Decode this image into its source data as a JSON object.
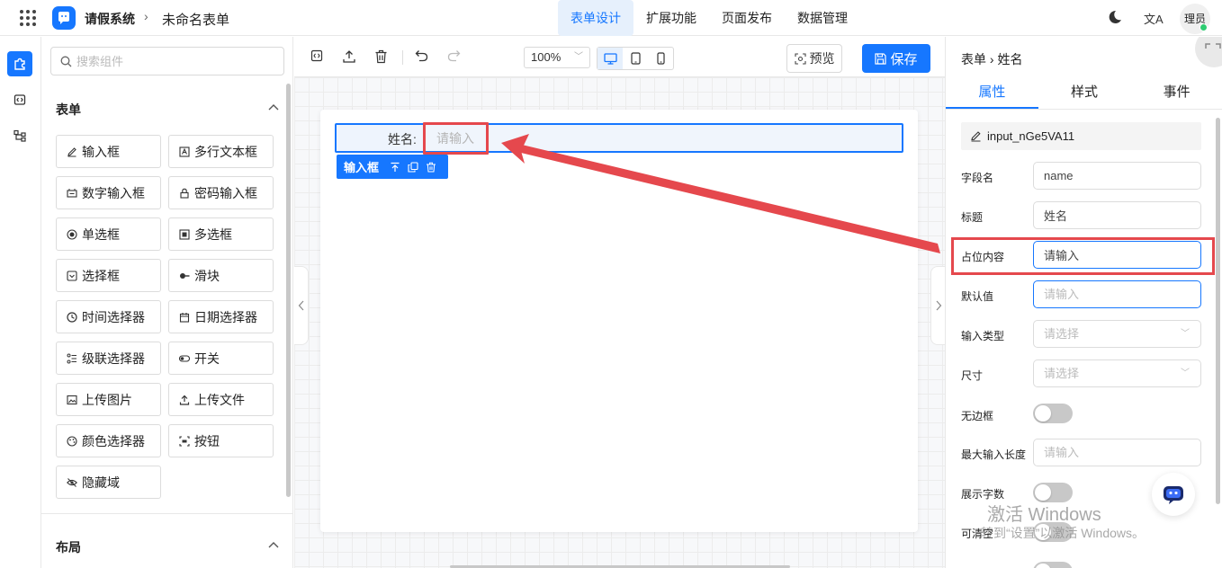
{
  "header": {
    "app_title": "请假系统",
    "separator": "›",
    "form_name": "未命名表单",
    "tabs": [
      "表单设计",
      "扩展功能",
      "页面发布",
      "数据管理"
    ],
    "lang_label": "文A",
    "avatar_text": "理员"
  },
  "components": {
    "search_placeholder": "搜索组件",
    "group_form": "表单",
    "items": [
      "输入框",
      "多行文本框",
      "数字输入框",
      "密码输入框",
      "单选框",
      "多选框",
      "选择框",
      "滑块",
      "时间选择器",
      "日期选择器",
      "级联选择器",
      "开关",
      "上传图片",
      "上传文件",
      "颜色选择器",
      "按钮",
      "隐藏域"
    ],
    "group_layout": "布局"
  },
  "toolbar": {
    "zoom": "100%",
    "preview_label": "预览",
    "save_label": "保存"
  },
  "canvas": {
    "field_label": "姓名:",
    "field_placeholder": "请输入",
    "tag_label": "输入框"
  },
  "properties": {
    "crumb": "表单 › 姓名",
    "tabs": [
      "属性",
      "样式",
      "事件"
    ],
    "id": "input_nGe5VA11",
    "fields": {
      "field_name_label": "字段名",
      "field_name_value": "name",
      "title_label": "标题",
      "title_value": "姓名",
      "placeholder_label": "占位内容",
      "placeholder_value": "请输入",
      "default_label": "默认值",
      "default_placeholder": "请输入",
      "input_type_label": "输入类型",
      "input_type_placeholder": "请选择",
      "size_label": "尺寸",
      "size_placeholder": "请选择",
      "no_border_label": "无边框",
      "max_length_label": "最大输入长度",
      "max_length_placeholder": "请输入",
      "show_count_label": "展示字数",
      "clearable_label": "可清空"
    }
  },
  "watermark": {
    "line1": "激活 Windows",
    "line2": "转到“设置”以激活 Windows。"
  },
  "colors": {
    "primary": "#1677ff",
    "annotation_red": "#e5484d"
  }
}
